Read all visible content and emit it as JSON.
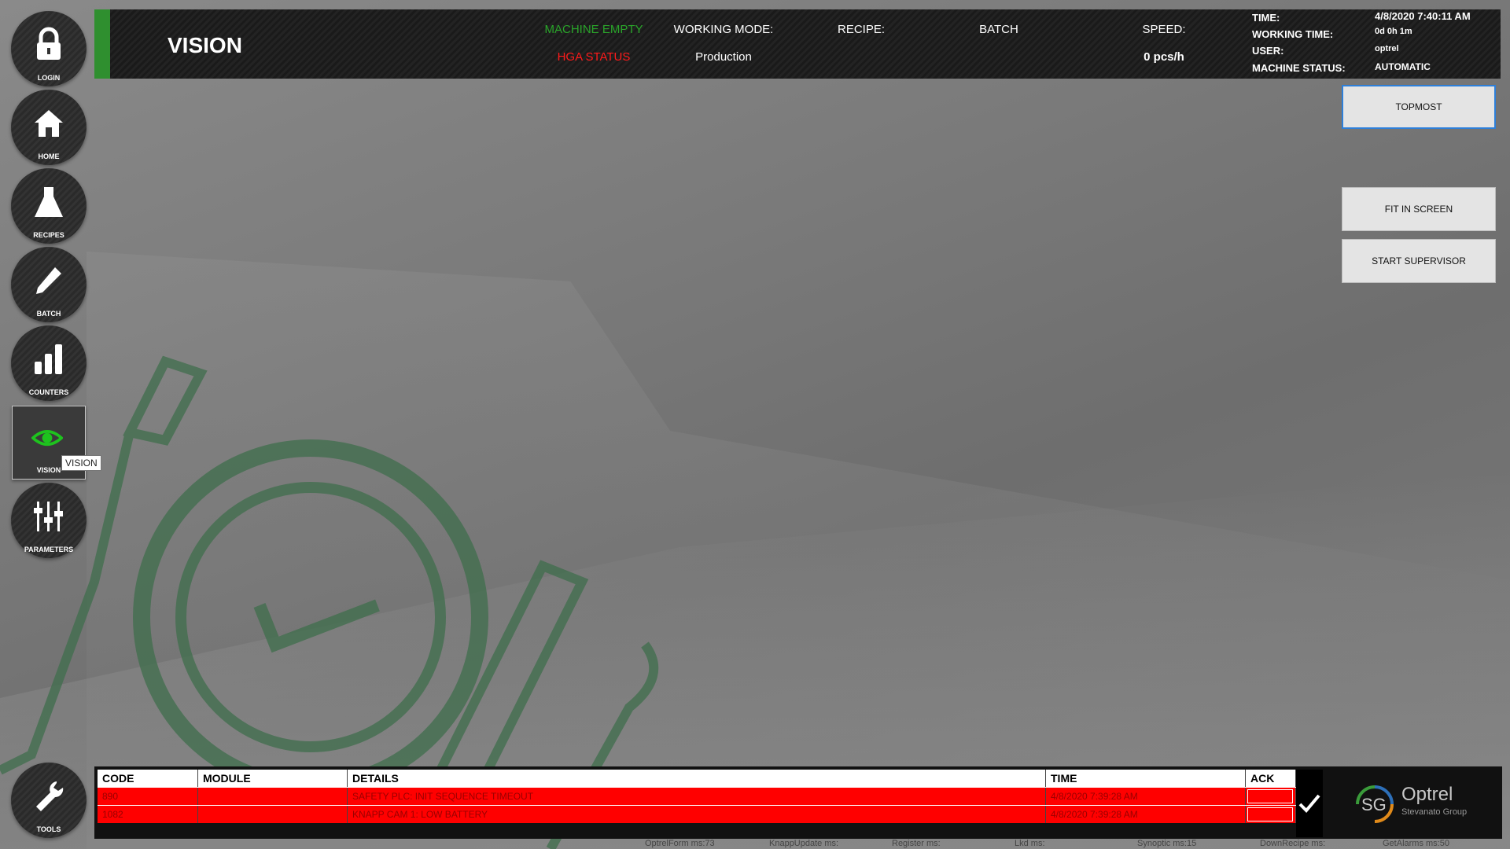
{
  "header": {
    "title": "VISION",
    "machine_empty": "MACHINE EMPTY",
    "hga_status": "HGA STATUS",
    "working_mode_label": "WORKING MODE:",
    "working_mode_value": "Production",
    "recipe_label": "RECIPE:",
    "recipe_value": "",
    "batch_label": "BATCH",
    "speed_label": "SPEED:",
    "speed_value": "0 pcs/h",
    "time_label": "TIME:",
    "time_value": "4/8/2020 7:40:11 AM",
    "working_time_label": "WORKING TIME:",
    "working_time_value": "0d 0h 1m",
    "user_label": "USER:",
    "user_value": "optrel",
    "machine_status_label": "MACHINE STATUS:",
    "machine_status_value": "AUTOMATIC"
  },
  "nav": {
    "login": "LOGIN",
    "home": "HOME",
    "recipes": "RECIPES",
    "batch": "BATCH",
    "counters": "COUNTERS",
    "vision": "VISION",
    "parameters": "PARAMETERS",
    "tools": "TOOLS",
    "tooltip": "VISION"
  },
  "buttons": {
    "topmost": "TOPMOST",
    "fit_in_screen": "FIT IN SCREEN",
    "start_supervisor": "START SUPERVISOR"
  },
  "alarms": {
    "columns": [
      "CODE",
      "MODULE",
      "DETAILS",
      "TIME",
      "ACK"
    ],
    "rows": [
      {
        "code": "890",
        "module": "",
        "details": "SAFETY PLC: INIT SEQUENCE TIMEOUT",
        "time": "4/8/2020 7:39:28 AM"
      },
      {
        "code": "1082",
        "module": "",
        "details": "KNAPP CAM 1: LOW BATTERY",
        "time": "4/8/2020 7:39:28 AM"
      }
    ]
  },
  "logo": {
    "brand": "Optrel",
    "sub": "Stevanato Group",
    "mark": "SG"
  },
  "footer": {
    "optrelform": "OptrelForm ms:73",
    "knappupdate": "KnappUpdate ms:",
    "register": "Register ms:",
    "lkd": "Lkd ms:",
    "synoptic": "Synoptic ms:15",
    "downrecipe": "DownRecipe ms:",
    "getalarms": "GetAlarms ms:50"
  },
  "colors": {
    "accent_green": "#2f8f2f",
    "alarm_red": "#ff0000",
    "icon_green": "#1ec31e"
  }
}
